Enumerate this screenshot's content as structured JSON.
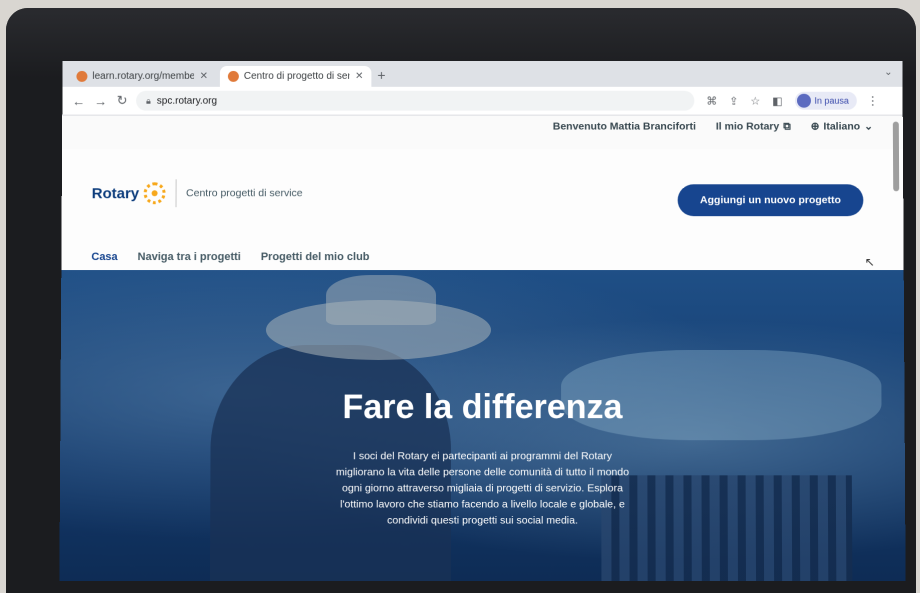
{
  "browser": {
    "tabs": [
      {
        "title": "learn.rotary.org/members/page",
        "active": false
      },
      {
        "title": "Centro di progetto di servizio",
        "active": true
      }
    ],
    "address": "spc.rotary.org",
    "profile_status": "In pausa"
  },
  "utility_bar": {
    "welcome": "Benvenuto Mattia Branciforti",
    "my_rotary": "Il mio Rotary",
    "language": "Italiano"
  },
  "header": {
    "brand": "Rotary",
    "site_name": "Centro progetti di service",
    "cta_label": "Aggiungi un nuovo progetto",
    "nav": [
      {
        "label": "Casa",
        "active": true
      },
      {
        "label": "Naviga tra i progetti",
        "active": false
      },
      {
        "label": "Progetti del mio club",
        "active": false
      }
    ]
  },
  "hero": {
    "title": "Fare la differenza",
    "text": "I soci del Rotary ei partecipanti ai programmi del Rotary migliorano la vita delle persone delle comunità di tutto il mondo ogni giorno attraverso migliaia di progetti di servizio. Esplora l'ottimo lavoro che stiamo facendo a livello locale e globale, e condividi questi progetti sui social media."
  },
  "colors": {
    "brand_blue": "#17458f",
    "rotary_gold": "#f7a81b"
  }
}
